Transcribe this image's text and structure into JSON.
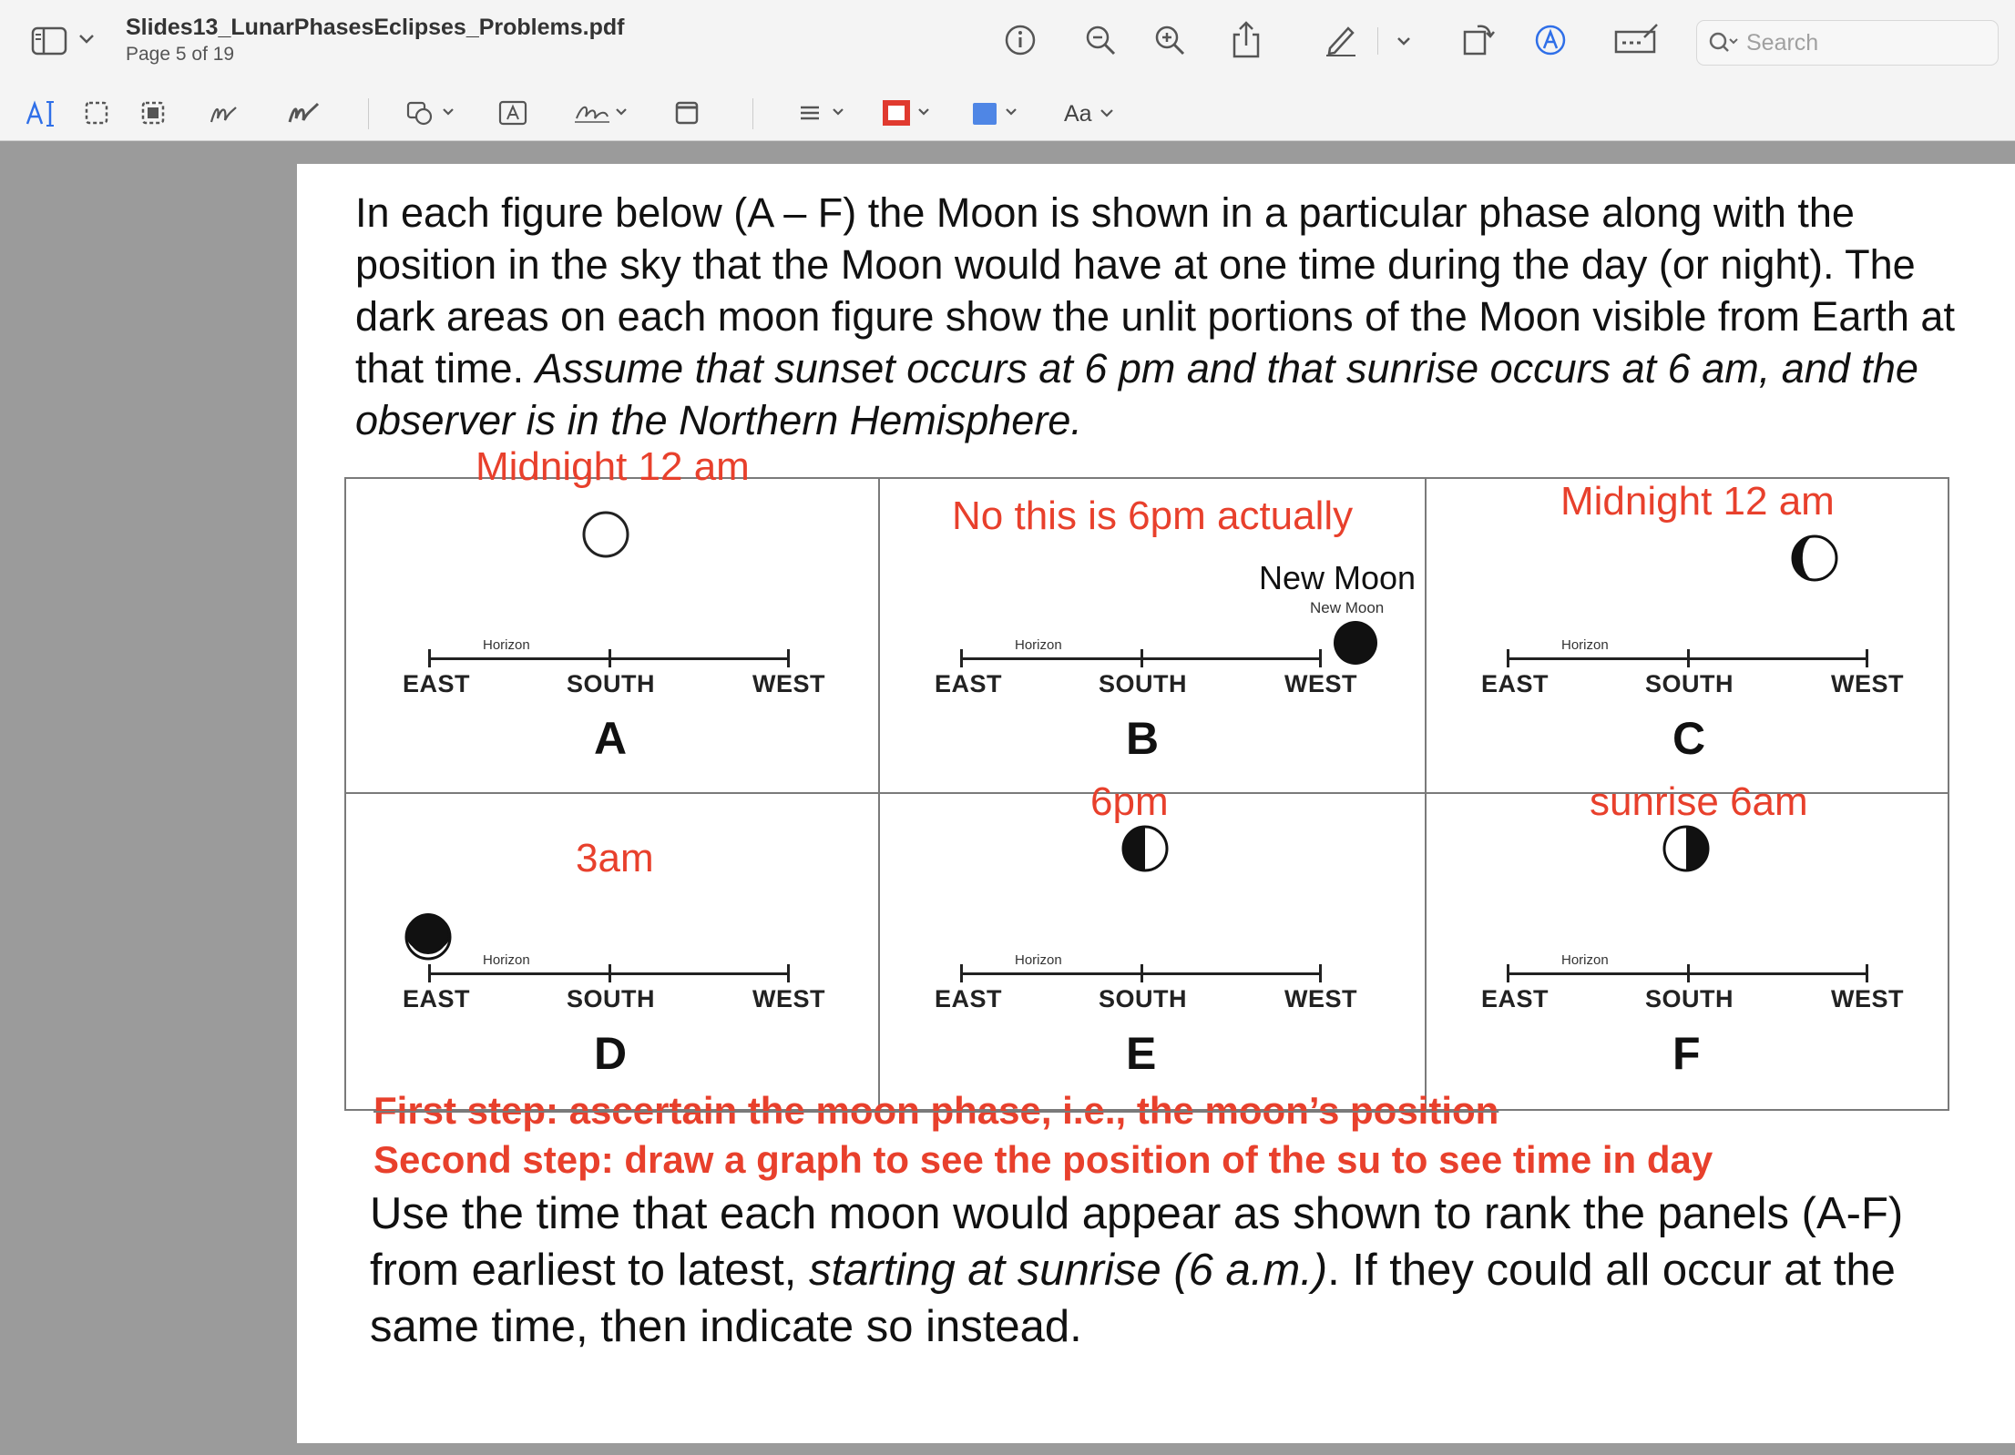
{
  "window": {
    "title": "Slides13_LunarPhasesEclipses_Problems.pdf",
    "page_indicator": "Page 5 of 19",
    "search_placeholder": "Search"
  },
  "toolbar": {
    "text_size_label": "Aa",
    "icons": [
      "sidebar-icon",
      "info-icon",
      "zoom-out-icon",
      "zoom-in-icon",
      "share-icon",
      "markup-pen-icon",
      "rotate-icon",
      "markup-circle-icon",
      "signature-box-icon",
      "search-icon",
      "text-select-icon",
      "rect-select-icon",
      "redact-icon",
      "sketch-icon",
      "draw-icon",
      "shapes-icon",
      "text-box-icon",
      "sign-icon",
      "note-icon",
      "lines-icon",
      "border-color-icon",
      "fill-color-icon"
    ]
  },
  "colors": {
    "annotation_red": "#e8402c",
    "annotation_blue": "#4a86e8",
    "border_swatch": "#e03a2f",
    "fill_swatch": "#4f86e5"
  },
  "document": {
    "intro_plain": "In each figure below (A – F) the Moon is shown in a particular phase along with the position in the sky that the Moon would have at one time during the day (or night). The dark areas on each moon figure show the unlit portions of the Moon visible from Earth at that time. ",
    "intro_italic": "Assume that sunset occurs at 6 pm and that sunrise occurs at 6 am, and the observer is in the Northern Hemisphere.",
    "question_a": "Use the time that each moon would appear as shown to rank the panels (A-F) from earliest to latest, ",
    "question_italic": "starting at sunrise (6 a.m.)",
    "question_b": ".  If they could all occur at the same time, then indicate so instead.",
    "step1": "First step: ascertain the moon phase, i.e., the moon’s position",
    "step2": "Second step: draw a graph to see the position of the su to see time in day"
  },
  "panels": [
    {
      "letter": "A",
      "east": "EAST",
      "south": "SOUTH",
      "west": "WEST",
      "horizon": "Horizon",
      "annotation": "Midnight 12 am"
    },
    {
      "letter": "B",
      "east": "EAST",
      "south": "SOUTH",
      "west": "WEST",
      "horizon": "Horizon",
      "annotation": "No this is 6pm actually",
      "annotation2": "New Moon",
      "small_label": "New Moon"
    },
    {
      "letter": "C",
      "east": "EAST",
      "south": "SOUTH",
      "west": "WEST",
      "horizon": "Horizon",
      "annotation": "Midnight 12 am"
    },
    {
      "letter": "D",
      "east": "EAST",
      "south": "SOUTH",
      "west": "WEST",
      "horizon": "Horizon",
      "annotation": "3am"
    },
    {
      "letter": "E",
      "east": "EAST",
      "south": "SOUTH",
      "west": "WEST",
      "horizon": "Horizon",
      "annotation": "6pm"
    },
    {
      "letter": "F",
      "east": "EAST",
      "south": "SOUTH",
      "west": "WEST",
      "horizon": "Horizon",
      "annotation": "sunrise 6am"
    }
  ]
}
